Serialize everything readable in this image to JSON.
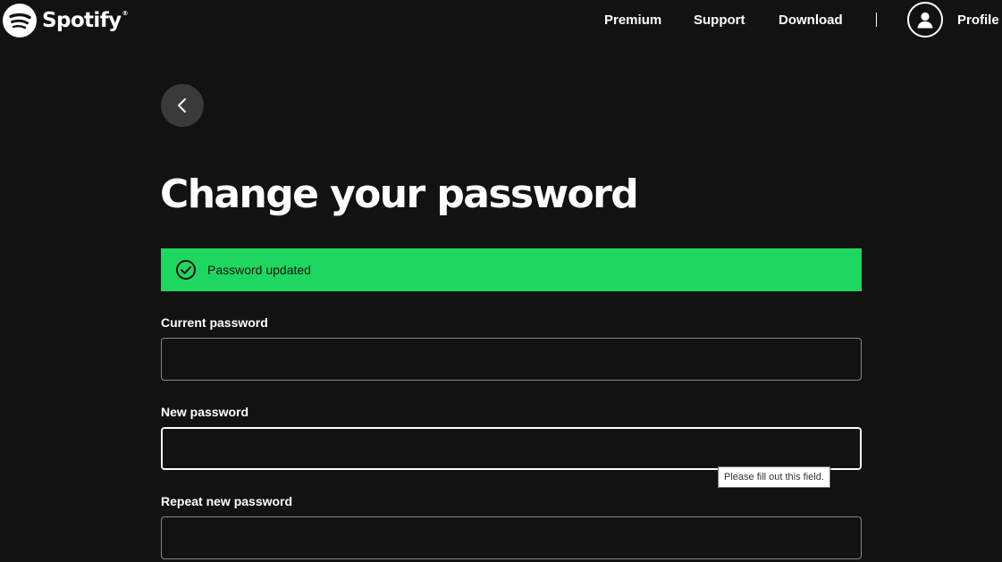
{
  "header": {
    "brand": "Spotify",
    "brand_mark": "®",
    "nav": {
      "premium": "Premium",
      "support": "Support",
      "download": "Download"
    },
    "profile_label": "Profile"
  },
  "page": {
    "title": "Change your password"
  },
  "alert": {
    "message": "Password updated",
    "color": "#1ed760",
    "icon": "check-circle-icon"
  },
  "form": {
    "current_password": {
      "label": "Current password",
      "value": ""
    },
    "new_password": {
      "label": "New password",
      "value": ""
    },
    "repeat_password": {
      "label": "Repeat new password",
      "value": ""
    }
  },
  "validation_tooltip": "Please fill out this field.",
  "colors": {
    "background": "#121212",
    "accent": "#1ed760",
    "back_button": "#3a3a3a"
  }
}
